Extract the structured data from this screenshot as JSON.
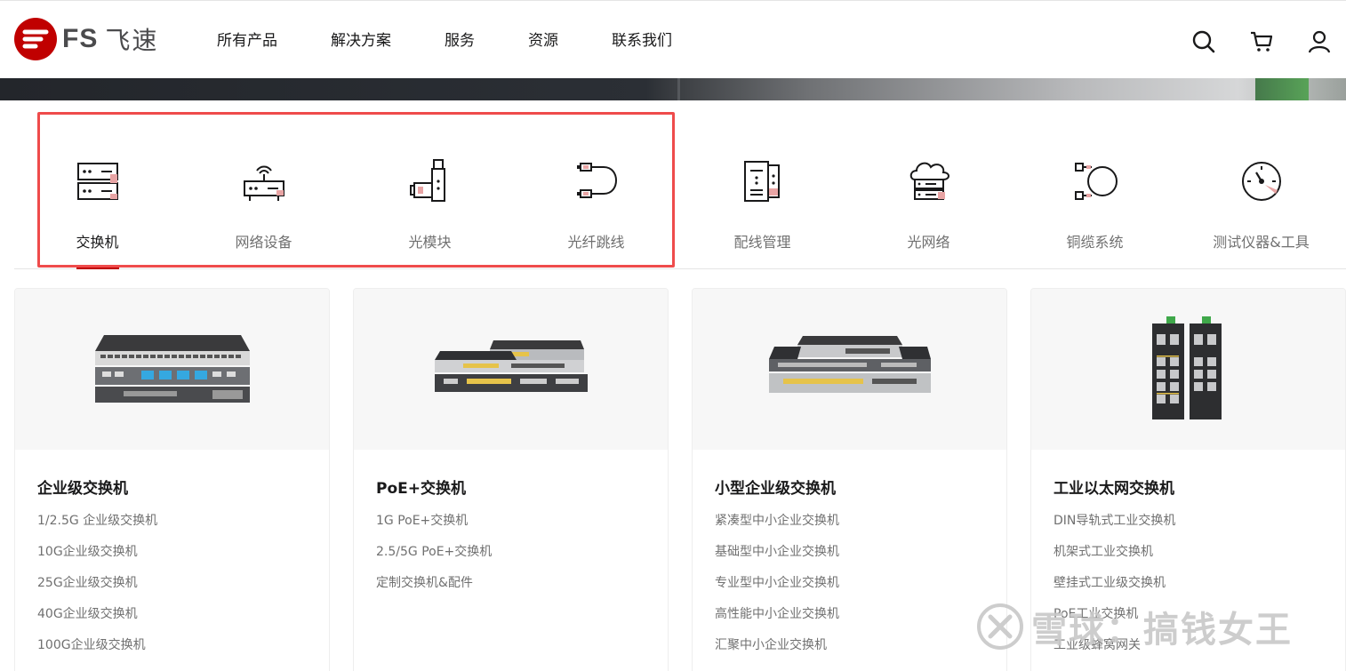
{
  "brand": {
    "logo_letters": "FS",
    "logo_cn": "飞速",
    "accent": "#c00000"
  },
  "nav": {
    "items": [
      "所有产品",
      "解决方案",
      "服务",
      "资源",
      "联系我们"
    ]
  },
  "header_icons": [
    "search-icon",
    "cart-icon",
    "account-icon"
  ],
  "categories": [
    {
      "label": "交换机",
      "icon": "switch-icon",
      "active": true
    },
    {
      "label": "网络设备",
      "icon": "router-icon",
      "active": false
    },
    {
      "label": "光模块",
      "icon": "transceiver-icon",
      "active": false
    },
    {
      "label": "光纤跳线",
      "icon": "fiber-patch-cable-icon",
      "active": false
    },
    {
      "label": "配线管理",
      "icon": "cabinet-icon",
      "active": false
    },
    {
      "label": "光网络",
      "icon": "cloud-network-icon",
      "active": false
    },
    {
      "label": "铜缆系统",
      "icon": "copper-cable-icon",
      "active": false
    },
    {
      "label": "测试仪器&工具",
      "icon": "gauge-icon",
      "active": false
    }
  ],
  "cards": [
    {
      "title": "企业级交换机",
      "links": [
        "1/2.5G 企业级交换机",
        "10G企业级交换机",
        "25G企业级交换机",
        "40G企业级交换机",
        "100G企业级交换机"
      ]
    },
    {
      "title": "PoE+交换机",
      "links": [
        "1G PoE+交换机",
        "2.5/5G PoE+交换机",
        "定制交换机&配件"
      ]
    },
    {
      "title": "小型企业级交换机",
      "links": [
        "紧凑型中小企业交换机",
        "基础型中小企业交换机",
        "专业型中小企业交换机",
        "高性能中小企业交换机",
        "汇聚中小企业交换机"
      ]
    },
    {
      "title": "工业以太网交换机",
      "links": [
        "DIN导轨式工业交换机",
        "机架式工业交换机",
        "壁挂式工业级交换机",
        "PoE工业交换机",
        "工业级蜂窝网关"
      ]
    }
  ],
  "watermark": {
    "text": "雪球：搞钱女王"
  }
}
